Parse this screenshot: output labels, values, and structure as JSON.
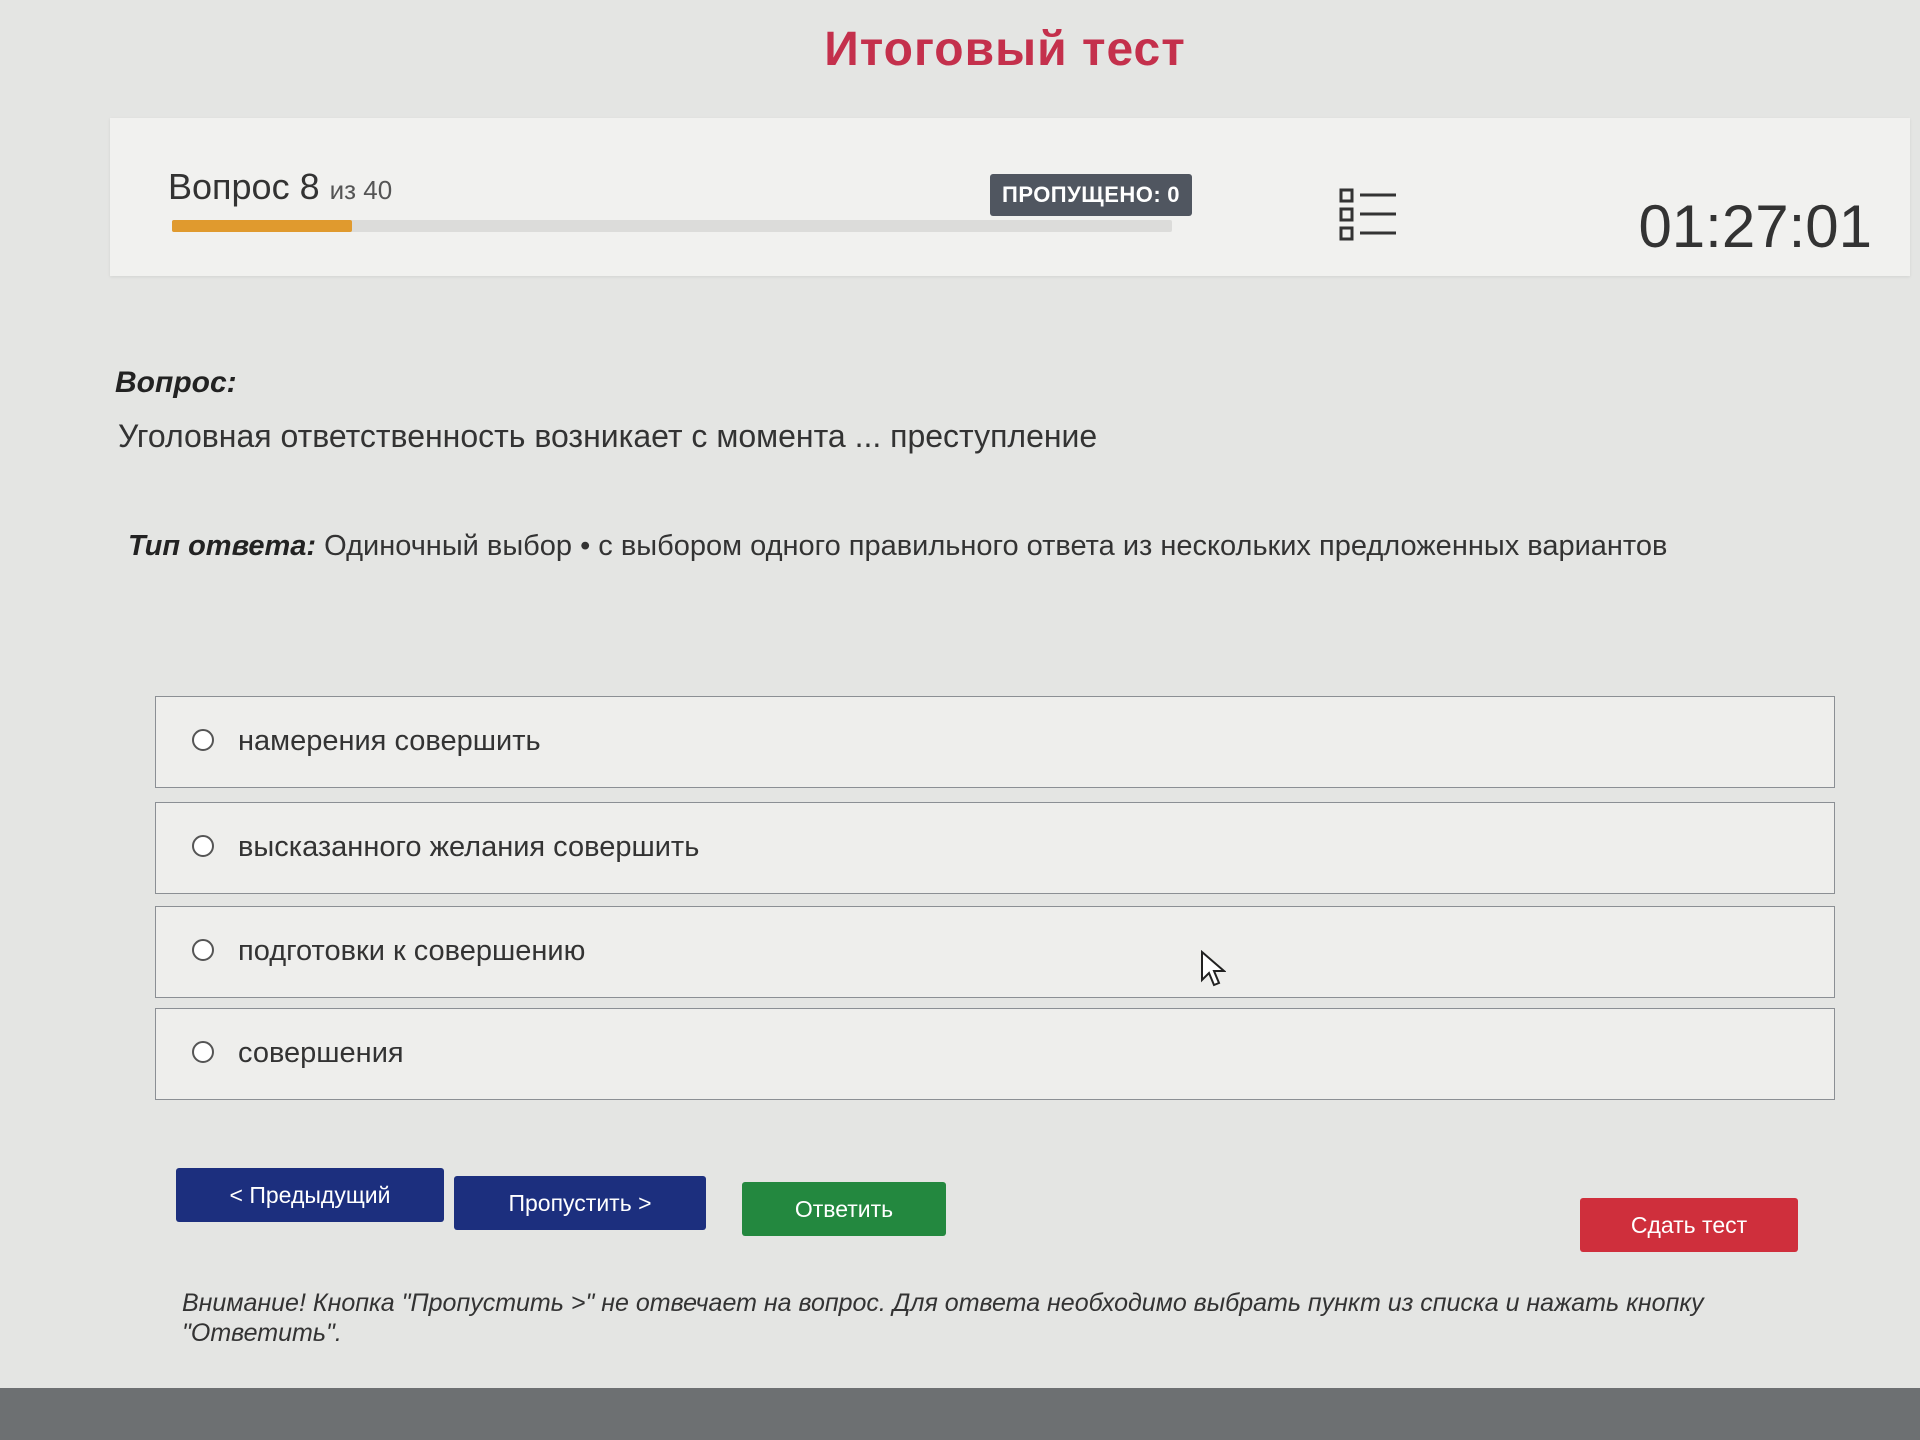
{
  "page": {
    "title": "Итоговый тест"
  },
  "header": {
    "question_word": "Вопрос",
    "question_number": "8",
    "of_total": "из 40",
    "progress": 0.18,
    "skipped_label": "ПРОПУЩЕНО:",
    "skipped_count": "0",
    "timer": "01:27:01",
    "list_icon": "question-list-icon"
  },
  "question": {
    "label": "Вопрос:",
    "text": "Уголовная ответственность возникает с момента ... преступление"
  },
  "answer_type": {
    "label": "Тип ответа:",
    "value": "Одиночный выбор • с выбором одного правильного ответа из нескольких предложенных вариантов"
  },
  "options": [
    {
      "label": "намерения совершить"
    },
    {
      "label": "высказанного желания совершить"
    },
    {
      "label": "подготовки к совершению"
    },
    {
      "label": "совершения"
    }
  ],
  "buttons": {
    "prev": "< Предыдущий",
    "skip": "Пропустить >",
    "answer": "Ответить",
    "submit": "Сдать тест"
  },
  "warning": "Внимание! Кнопка \"Пропустить >\" не отвечает на вопрос. Для ответа необходимо выбрать пункт из списка и нажать кнопку \"Ответить\".",
  "colors": {
    "title": "#c4304c",
    "progress": "#e09a2e",
    "primary_button": "#1c2f7e",
    "answer_button": "#23883f",
    "submit_button": "#cf2f3c"
  }
}
